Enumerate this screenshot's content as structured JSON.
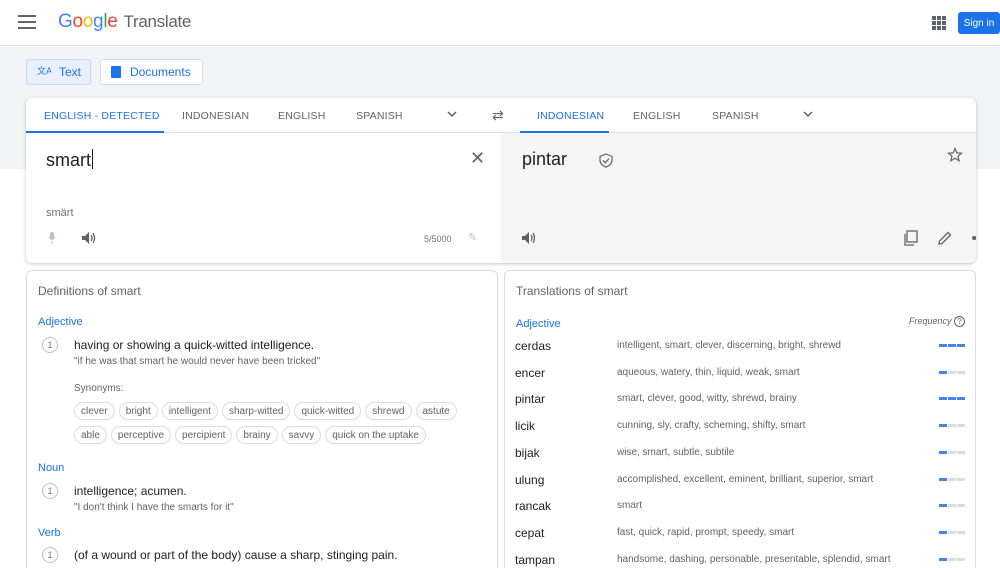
{
  "header": {
    "logo_letters": [
      "G",
      "o",
      "o",
      "g",
      "l",
      "e"
    ],
    "product": "Translate",
    "sign_in": "Sign in"
  },
  "modes": {
    "text": "Text",
    "documents": "Documents"
  },
  "source_langs": [
    "ENGLISH - DETECTED",
    "INDONESIAN",
    "ENGLISH",
    "SPANISH"
  ],
  "target_langs": [
    "INDONESIAN",
    "ENGLISH",
    "SPANISH"
  ],
  "source": {
    "text": "smart",
    "transliteration": "smärt",
    "char_count": "5/5000"
  },
  "target": {
    "text": "pintar"
  },
  "definitions": {
    "title": "Definitions of smart",
    "adjective_label": "Adjective",
    "adj_def": "having or showing a quick-witted intelligence.",
    "adj_example": "\"if he was that smart he would never have been tricked\"",
    "synonyms_label": "Synonyms:",
    "synonyms_row1": [
      "clever",
      "bright",
      "intelligent",
      "sharp-witted",
      "quick-witted",
      "shrewd",
      "astute"
    ],
    "synonyms_row2": [
      "able",
      "perceptive",
      "percipient",
      "brainy",
      "savvy",
      "quick on the uptake"
    ],
    "noun_label": "Noun",
    "noun_def": "intelligence; acumen.",
    "noun_example": "\"I don't think I have the smarts for it\"",
    "verb_label": "Verb",
    "verb_def": "(of a wound or part of the body) cause a sharp, stinging pain.",
    "num": "1"
  },
  "translations": {
    "title": "Translations of smart",
    "adjective_label": "Adjective",
    "frequency_label": "Frequency",
    "rows": [
      {
        "word": "cerdas",
        "synonyms": "intelligent, smart, clever, discerning, bright, shrewd",
        "freq": 3
      },
      {
        "word": "encer",
        "synonyms": "aqueous, watery, thin, liquid, weak, smart",
        "freq": 1
      },
      {
        "word": "pintar",
        "synonyms": "smart, clever, good, witty, shrewd, brainy",
        "freq": 3
      },
      {
        "word": "licik",
        "synonyms": "cunning, sly, crafty, scheming, shifty, smart",
        "freq": 1
      },
      {
        "word": "bijak",
        "synonyms": "wise, smart, subtle, subtile",
        "freq": 1
      },
      {
        "word": "ulung",
        "synonyms": "accomplished, excellent, eminent, brilliant, superior, smart",
        "freq": 1
      },
      {
        "word": "rancak",
        "synonyms": "smart",
        "freq": 1
      },
      {
        "word": "cepat",
        "synonyms": "fast, quick, rapid, prompt, speedy, smart",
        "freq": 1
      },
      {
        "word": "tampan",
        "synonyms": "handsome, dashing, personable, presentable, splendid, smart",
        "freq": 1
      }
    ]
  },
  "colors": {
    "accent": "#1a73e8",
    "freq_on": "#4285f4",
    "freq_off": "#dadce0"
  }
}
